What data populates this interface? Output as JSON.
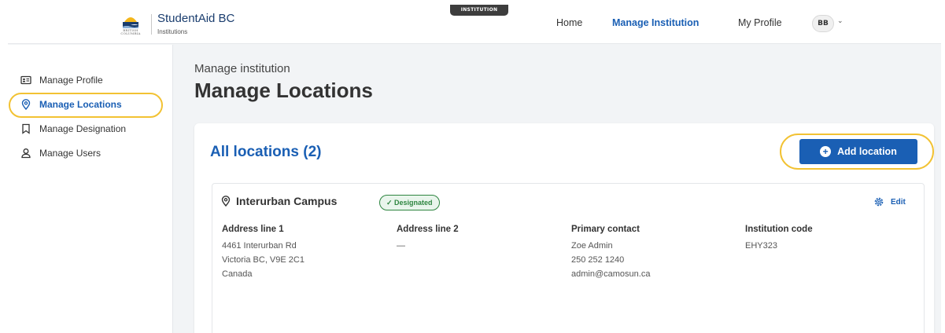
{
  "header": {
    "logo_text": "BRITISH COLUMBIA",
    "brand_title": "StudentAid BC",
    "brand_subtitle": "Institutions",
    "env_badge": "INSTITUTION",
    "nav": [
      {
        "label": "Home",
        "active": false
      },
      {
        "label": "Manage Institution",
        "active": true
      },
      {
        "label": "My Profile",
        "active": false
      }
    ],
    "avatar_initials": "BB"
  },
  "sidebar": {
    "items": [
      {
        "label": "Manage Profile",
        "icon": "id-card-icon",
        "active": false
      },
      {
        "label": "Manage Locations",
        "icon": "map-pin-icon",
        "active": true
      },
      {
        "label": "Manage Designation",
        "icon": "bookmark-icon",
        "active": false
      },
      {
        "label": "Manage Users",
        "icon": "user-icon",
        "active": false
      }
    ]
  },
  "main": {
    "breadcrumb": "Manage institution",
    "title": "Manage Locations",
    "card": {
      "heading": "All locations (2)",
      "add_button_label": "Add location",
      "location": {
        "name": "Interurban Campus",
        "badge": "Designated",
        "edit_label": "Edit",
        "columns": [
          {
            "header": "Address line 1",
            "lines": [
              "4461 Interurban Rd",
              "Victoria BC, V9E 2C1",
              "Canada"
            ]
          },
          {
            "header": "Address line 2",
            "lines": [
              "—"
            ]
          },
          {
            "header": "Primary contact",
            "lines": [
              "Zoe Admin",
              "250 252 1240",
              "admin@camosun.ca"
            ]
          },
          {
            "header": "Institution code",
            "lines": [
              "EHY323"
            ]
          }
        ]
      }
    }
  },
  "colors": {
    "primary_blue": "#1a5fb4",
    "highlight_yellow": "#f2c233",
    "designated_green": "#2e8540",
    "page_bg": "#f2f4f6"
  }
}
